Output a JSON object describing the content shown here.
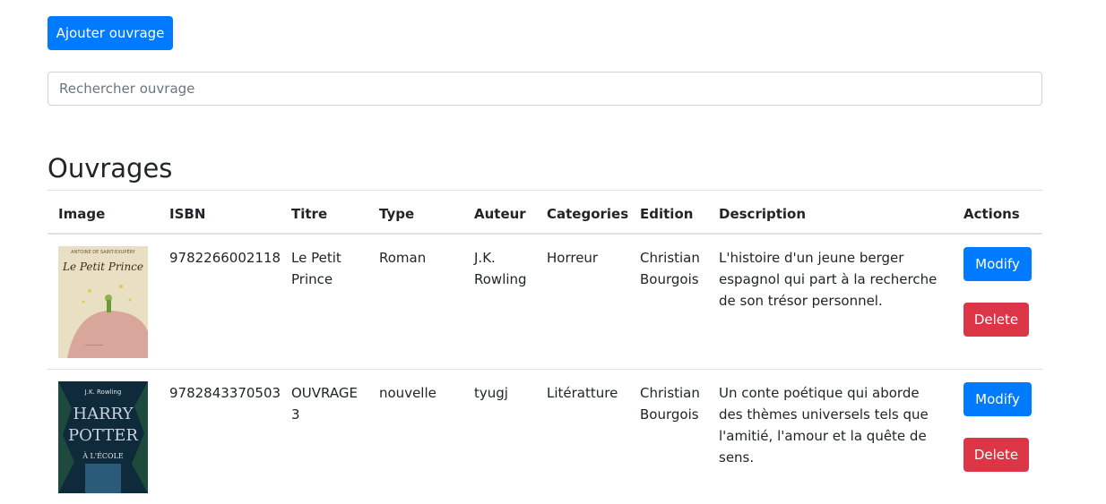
{
  "toolbar": {
    "add_label": "Ajouter ouvrage"
  },
  "search": {
    "placeholder": "Rechercher ouvrage",
    "value": ""
  },
  "page_title": "Ouvrages",
  "table": {
    "headers": [
      "Image",
      "ISBN",
      "Titre",
      "Type",
      "Auteur",
      "Categories",
      "Edition",
      "Description",
      "Actions"
    ],
    "rows": [
      {
        "image": "Le Petit Prince cover",
        "image_author_text": "ANTOINE DE SAINT-EXUPÉRY",
        "image_title_text": "Le Petit Prince",
        "isbn": "9782266002118",
        "titre": "Le Petit Prince",
        "type": "Roman",
        "auteur": "J.K. Rowling",
        "categories": "Horreur",
        "edition": "Christian Bourgois",
        "description": "L'histoire d'un jeune berger espagnol qui part à la recherche de son trésor personnel.",
        "modify_label": "Modify",
        "delete_label": "Delete"
      },
      {
        "image": "Harry Potter cover",
        "image_author_text": "J.K. Rowling",
        "image_title_text": "HARRY POTTER",
        "image_subtitle_text": "À L'ÉCOLE",
        "isbn": "9782843370503",
        "titre": "OUVRAGE 3",
        "type": "nouvelle",
        "auteur": "tyugj",
        "categories": "Litératture",
        "edition": "Christian Bourgois",
        "description": "Un conte poétique qui aborde des thèmes universels tels que l'amitié, l'amour et la quête de sens.",
        "modify_label": "Modify",
        "delete_label": "Delete"
      }
    ]
  },
  "colors": {
    "primary": "#007bff",
    "danger": "#dc3545",
    "border": "#dee2e6"
  }
}
